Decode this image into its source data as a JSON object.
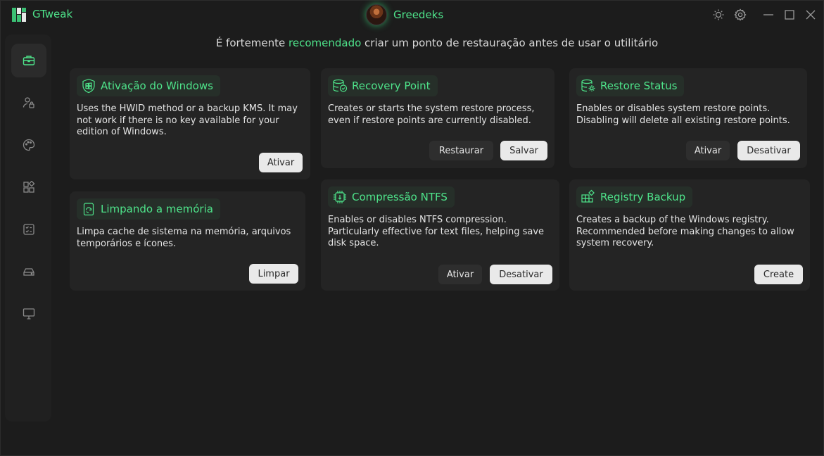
{
  "app": {
    "title": "GTweak",
    "user_name": "Greedeks"
  },
  "headline": {
    "prefix": "É fortemente ",
    "highlight": "recomendado",
    "suffix": " criar um ponto de restauração antes de usar o utilitário"
  },
  "colors": {
    "accent": "#4ee38a",
    "background": "#1c1c1c",
    "card": "#242424"
  },
  "sidebar": {
    "items": [
      {
        "icon": "briefcase-icon",
        "active": true
      },
      {
        "icon": "user-lock-icon",
        "active": false
      },
      {
        "icon": "palette-icon",
        "active": false
      },
      {
        "icon": "apps-icon",
        "active": false
      },
      {
        "icon": "checklist-icon",
        "active": false
      },
      {
        "icon": "drive-icon",
        "active": false
      },
      {
        "icon": "monitor-icon",
        "active": false
      }
    ]
  },
  "cards": {
    "activation": {
      "title": "Ativação do Windows",
      "desc": [
        "Uses the HWID method or a backup KMS. It may",
        "not work if there is no key available for your",
        "edition of Windows."
      ],
      "buttons": [
        "Ativar"
      ]
    },
    "memory": {
      "title": "Limpando a memória",
      "desc": [
        "Limpa cache de sistema na memória, arquivos",
        "temporários e ícones."
      ],
      "buttons": [
        "Limpar"
      ]
    },
    "recovery": {
      "title": "Recovery Point",
      "desc": [
        "Creates or starts the system restore process,",
        "even if restore points are currently disabled."
      ],
      "buttons": [
        "Restaurar",
        "Salvar"
      ]
    },
    "ntfs": {
      "title": "Compressão NTFS",
      "desc": [
        "Enables or disables NTFS compression.",
        "Particularly effective for text files, helping save",
        "disk space."
      ],
      "buttons": [
        "Ativar",
        "Desativar"
      ]
    },
    "restore_status": {
      "title": "Restore Status",
      "desc": [
        "Enables or disables system restore points.",
        "Disabling will delete all existing restore points."
      ],
      "buttons": [
        "Ativar",
        "Desativar"
      ]
    },
    "registry": {
      "title": "Registry Backup",
      "desc": [
        "Creates a backup of the Windows registry.",
        "Recommended before making changes to allow",
        "system recovery."
      ],
      "buttons": [
        "Create"
      ]
    }
  }
}
